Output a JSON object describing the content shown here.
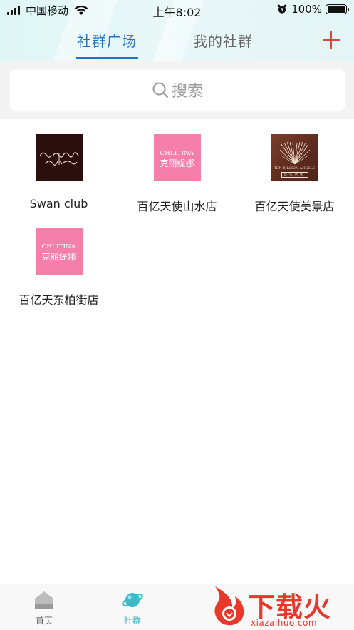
{
  "status_bar": {
    "carrier": "中国移动",
    "time": "上午8:02",
    "battery": "100%"
  },
  "tabs": [
    {
      "label": "社群广场",
      "active": true
    },
    {
      "label": "我的社群",
      "active": false
    }
  ],
  "search": {
    "placeholder": "搜索"
  },
  "groups": [
    {
      "name": "Swan club",
      "logo_text": "swanc club"
    },
    {
      "name": "百亿天使山水店",
      "logo_text_en": "CHLITINA",
      "logo_text_cn": "克丽缇娜"
    },
    {
      "name": "百亿天使美景店",
      "logo_text_en": "TEN BILLION ANGELS",
      "logo_text_cn": "百亿天使"
    },
    {
      "name": "百亿天东柏街店",
      "logo_text_en": "CHLITINA",
      "logo_text_cn": "克丽缇娜"
    }
  ],
  "bottom_nav": [
    {
      "label": "首页",
      "icon": "home-icon",
      "active": false
    },
    {
      "label": "社群",
      "icon": "planet-icon",
      "active": true
    }
  ],
  "watermark": {
    "text": "下载火",
    "url": "xiazaihuo.com"
  },
  "colors": {
    "accent": "#1f73c9",
    "plus": "#e0453f",
    "nav_active": "#3fb9c7",
    "watermark": "#e8382c"
  }
}
